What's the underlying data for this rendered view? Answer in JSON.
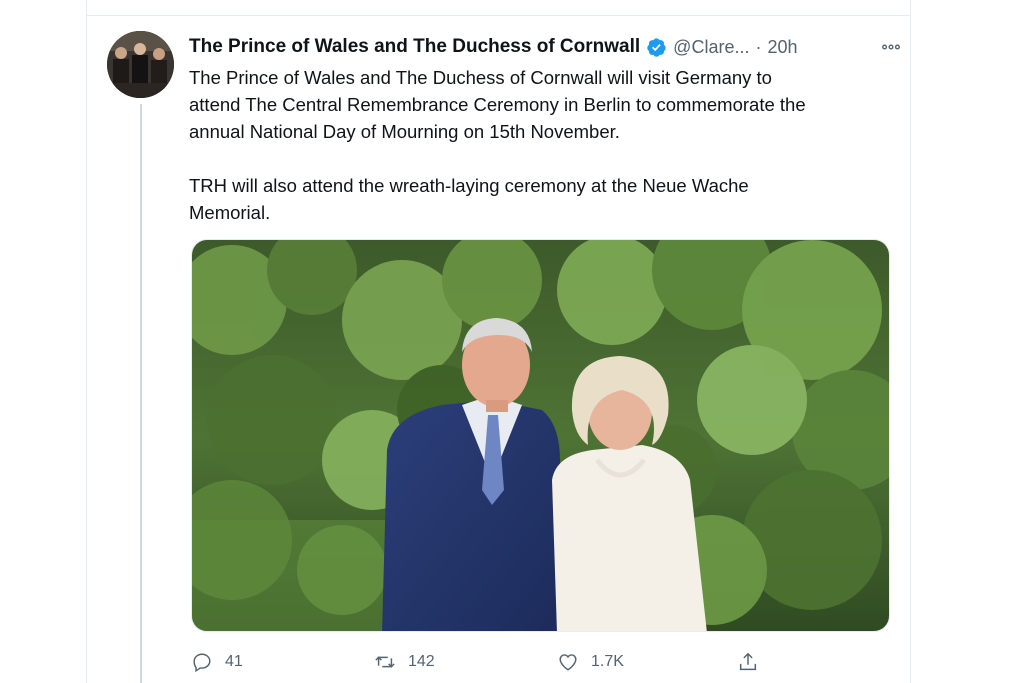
{
  "tweet": {
    "author_name": "The Prince of Wales and The Duchess of Cornwall",
    "handle": "@Clare...",
    "separator": "·",
    "time": "20h",
    "paragraphs": [
      [
        "The Prince of Wales and The Duchess of Cornwall will visit Germany to",
        "attend The Central Remembrance Ceremony in Berlin to commemorate the",
        "annual National Day of Mourning on 15th November."
      ],
      [
        "TRH will also attend the wreath-laying ceremony at the Neue Wache",
        "Memorial."
      ]
    ],
    "actions": {
      "reply_count": "41",
      "retweet_count": "142",
      "like_count": "1.7K"
    }
  },
  "icons": {
    "verified": "verified-badge-icon",
    "more": "more-options-icon",
    "reply": "reply-icon",
    "retweet": "retweet-icon",
    "like": "heart-icon",
    "share": "share-icon"
  },
  "colors": {
    "verified": "#1d9bf0",
    "secondary_text": "#536471",
    "primary_text": "#0f1419",
    "border": "#e6ecf0"
  }
}
